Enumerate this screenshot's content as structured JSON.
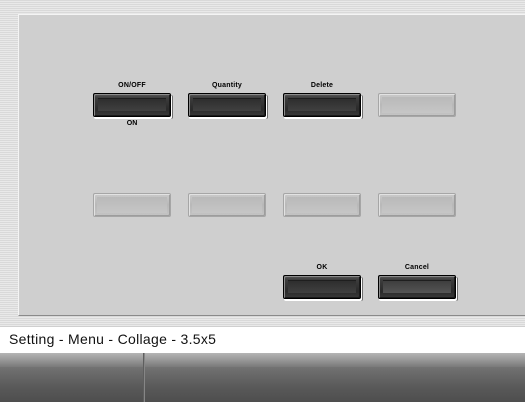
{
  "buttons": {
    "on_off": {
      "label": "ON/OFF",
      "value": "ON"
    },
    "quantity": {
      "label": "Quantity"
    },
    "delete": {
      "label": "Delete"
    },
    "ok": {
      "label": "OK"
    },
    "cancel": {
      "label": "Cancel"
    }
  },
  "status_bar": {
    "breadcrumb": "Setting - Menu - Collage - 3.5x5"
  },
  "colors": {
    "dark_button": "#2e2e2e",
    "disabled_button": "#bdbdbd",
    "panel": "#cfcfcf"
  }
}
